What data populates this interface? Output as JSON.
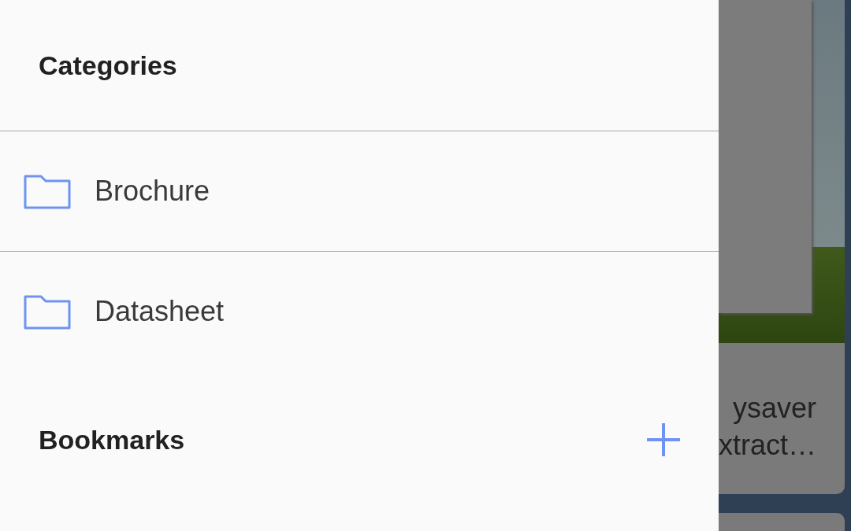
{
  "drawer": {
    "sections": [
      {
        "title": "Categories",
        "kind": "list",
        "items": [
          {
            "label": "Brochure"
          },
          {
            "label": "Datasheet"
          }
        ]
      },
      {
        "title": "Bookmarks",
        "kind": "add"
      }
    ]
  },
  "background_card": {
    "title_lines": [
      "ysaver",
      "xtract…"
    ]
  }
}
